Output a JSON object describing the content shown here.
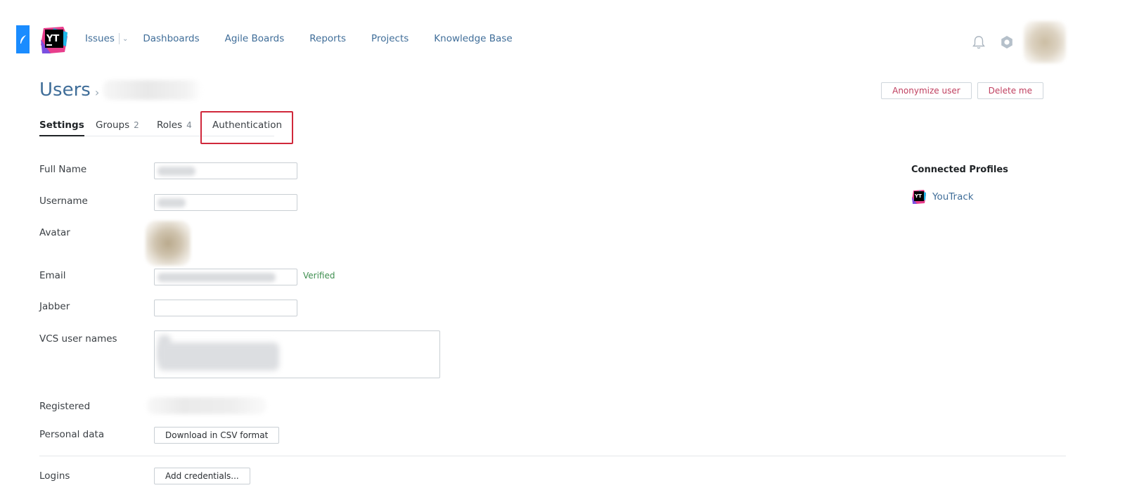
{
  "header": {
    "nav": [
      {
        "label": "Issues"
      },
      {
        "label": "Dashboards"
      },
      {
        "label": "Agile Boards"
      },
      {
        "label": "Reports"
      },
      {
        "label": "Projects"
      },
      {
        "label": "Knowledge Base"
      }
    ],
    "icons": {
      "side": "feather-icon",
      "logo": "youtrack-logo",
      "bell": "bell-icon",
      "gear": "gear-icon"
    }
  },
  "page": {
    "title": "Users",
    "breadcrumb_separator": "›"
  },
  "actions": {
    "anonymize": "Anonymize user",
    "delete": "Delete me"
  },
  "tabs": [
    {
      "label": "Settings",
      "count": ""
    },
    {
      "label": "Groups",
      "count": "2"
    },
    {
      "label": "Roles",
      "count": "4"
    },
    {
      "label": "Authentication",
      "count": ""
    }
  ],
  "form": {
    "full_name": "Full Name",
    "username": "Username",
    "avatar": "Avatar",
    "email": "Email",
    "email_status": "Verified",
    "jabber": "Jabber",
    "vcs": "VCS user names",
    "registered": "Registered",
    "personal_data": "Personal data",
    "download_csv": "Download in CSV format",
    "logins": "Logins",
    "add_credentials": "Add credentials..."
  },
  "connected": {
    "title": "Connected Profiles",
    "items": [
      {
        "label": "YouTrack",
        "icon": "youtrack-icon"
      }
    ]
  },
  "colors": {
    "link": "#406e99",
    "danger": "#c04060",
    "verified": "#3f8f50",
    "highlight": "#d0283b"
  }
}
